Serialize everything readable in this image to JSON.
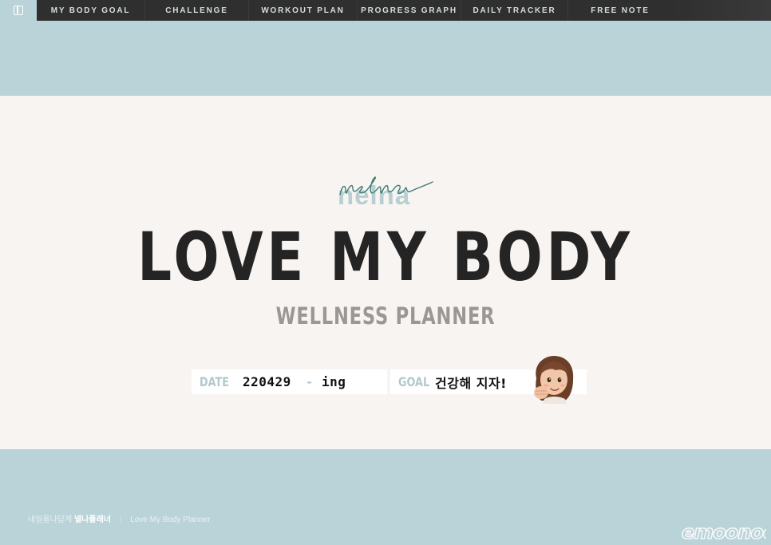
{
  "nav": {
    "items": [
      {
        "label": "MY BODY GOAL"
      },
      {
        "label": "CHALLENGE"
      },
      {
        "label": "WORKOUT PLAN"
      },
      {
        "label": "PROGRESS GRAPH"
      },
      {
        "label": "DAILY TRACKER"
      },
      {
        "label": "FREE NOTE"
      }
    ]
  },
  "hero": {
    "brand": "nelna",
    "title": "LOVE MY BODY",
    "subtitle": "WELLNESS PLANNER",
    "date_label": "DATE",
    "date_value": "220429",
    "date_dash": "-",
    "date_suffix": "ing",
    "goal_label": "GOAL",
    "goal_value": "건강해 지자!"
  },
  "footer": {
    "brand_prefix": "내일을나답게",
    "brand_name": "넬나플래너",
    "separator": "|",
    "planner_name": "Love My Body Planner",
    "watermark": "emoonoo"
  },
  "colors": {
    "background": "#b9d3d9",
    "hero_band": "#f8f4f2",
    "nav_bar": "#2f2f2f",
    "accent_teal": "#b7cfd2",
    "brand_script": "#3f7d74",
    "title": "#242424",
    "subtitle": "#9b9793"
  }
}
